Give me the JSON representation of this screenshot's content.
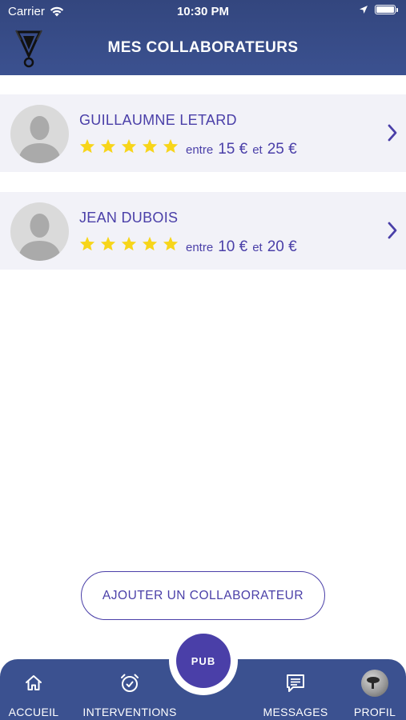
{
  "status_bar": {
    "carrier": "Carrier",
    "time": "10:30 PM"
  },
  "header": {
    "title": "MES COLLABORATEURS"
  },
  "collaborators": [
    {
      "name": "GUILLAUMNE LETARD",
      "stars": 5,
      "between": "entre",
      "min": "15 €",
      "and": "et",
      "max": "25 €"
    },
    {
      "name": "JEAN DUBOIS",
      "stars": 5,
      "between": "entre",
      "min": "10 €",
      "and": "et",
      "max": "20 €"
    }
  ],
  "add_button": {
    "label": "AJOUTER UN COLLABORATEUR"
  },
  "tabbar": {
    "home": "ACCUEIL",
    "interventions": "INTERVENTIONS",
    "pub": "PUB",
    "messages": "MESSAGES",
    "profile": "PROFIL"
  },
  "colors": {
    "header": "#3b5190",
    "accent": "#4a3fa8",
    "star": "#f7d51a",
    "card": "#f2f2f8"
  }
}
